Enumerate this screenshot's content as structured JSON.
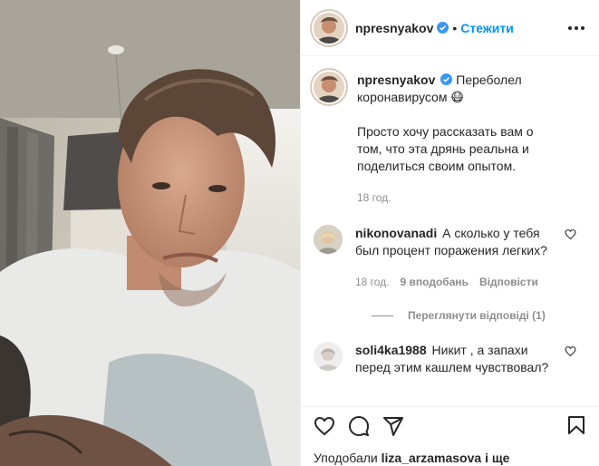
{
  "header": {
    "username": "npresnyakov",
    "dot": "•",
    "follow_label": "Стежити"
  },
  "caption": {
    "username": "npresnyakov",
    "line1": "Переболел коронавирусом 😷",
    "line2": "Просто хочу рассказать вам о том, что эта дрянь реальна и поделиться своим опытом.",
    "time": "18 год."
  },
  "comments": [
    {
      "username": "nikonovanadi",
      "text": "А сколько у тебя был процент поражения легких?",
      "time": "18 год.",
      "likes": "9 вподобань",
      "reply": "Відповісти",
      "view_replies": "Переглянути відповіді (1)"
    },
    {
      "username": "soli4ka1988",
      "text": "Никит , а запахи перед этим кашлем чувствовал?"
    }
  ],
  "footer": {
    "likes_prefix": "Уподобали",
    "likes_user": "liza_arzamasova",
    "likes_suffix": "і ще"
  },
  "icons": [
    "verified-icon",
    "more-options-icon",
    "heart-icon",
    "comment-icon",
    "share-icon",
    "bookmark-icon"
  ],
  "colors": {
    "follow": "#0095f6",
    "verified": "#3897f0",
    "meta": "#8e8e8e"
  }
}
